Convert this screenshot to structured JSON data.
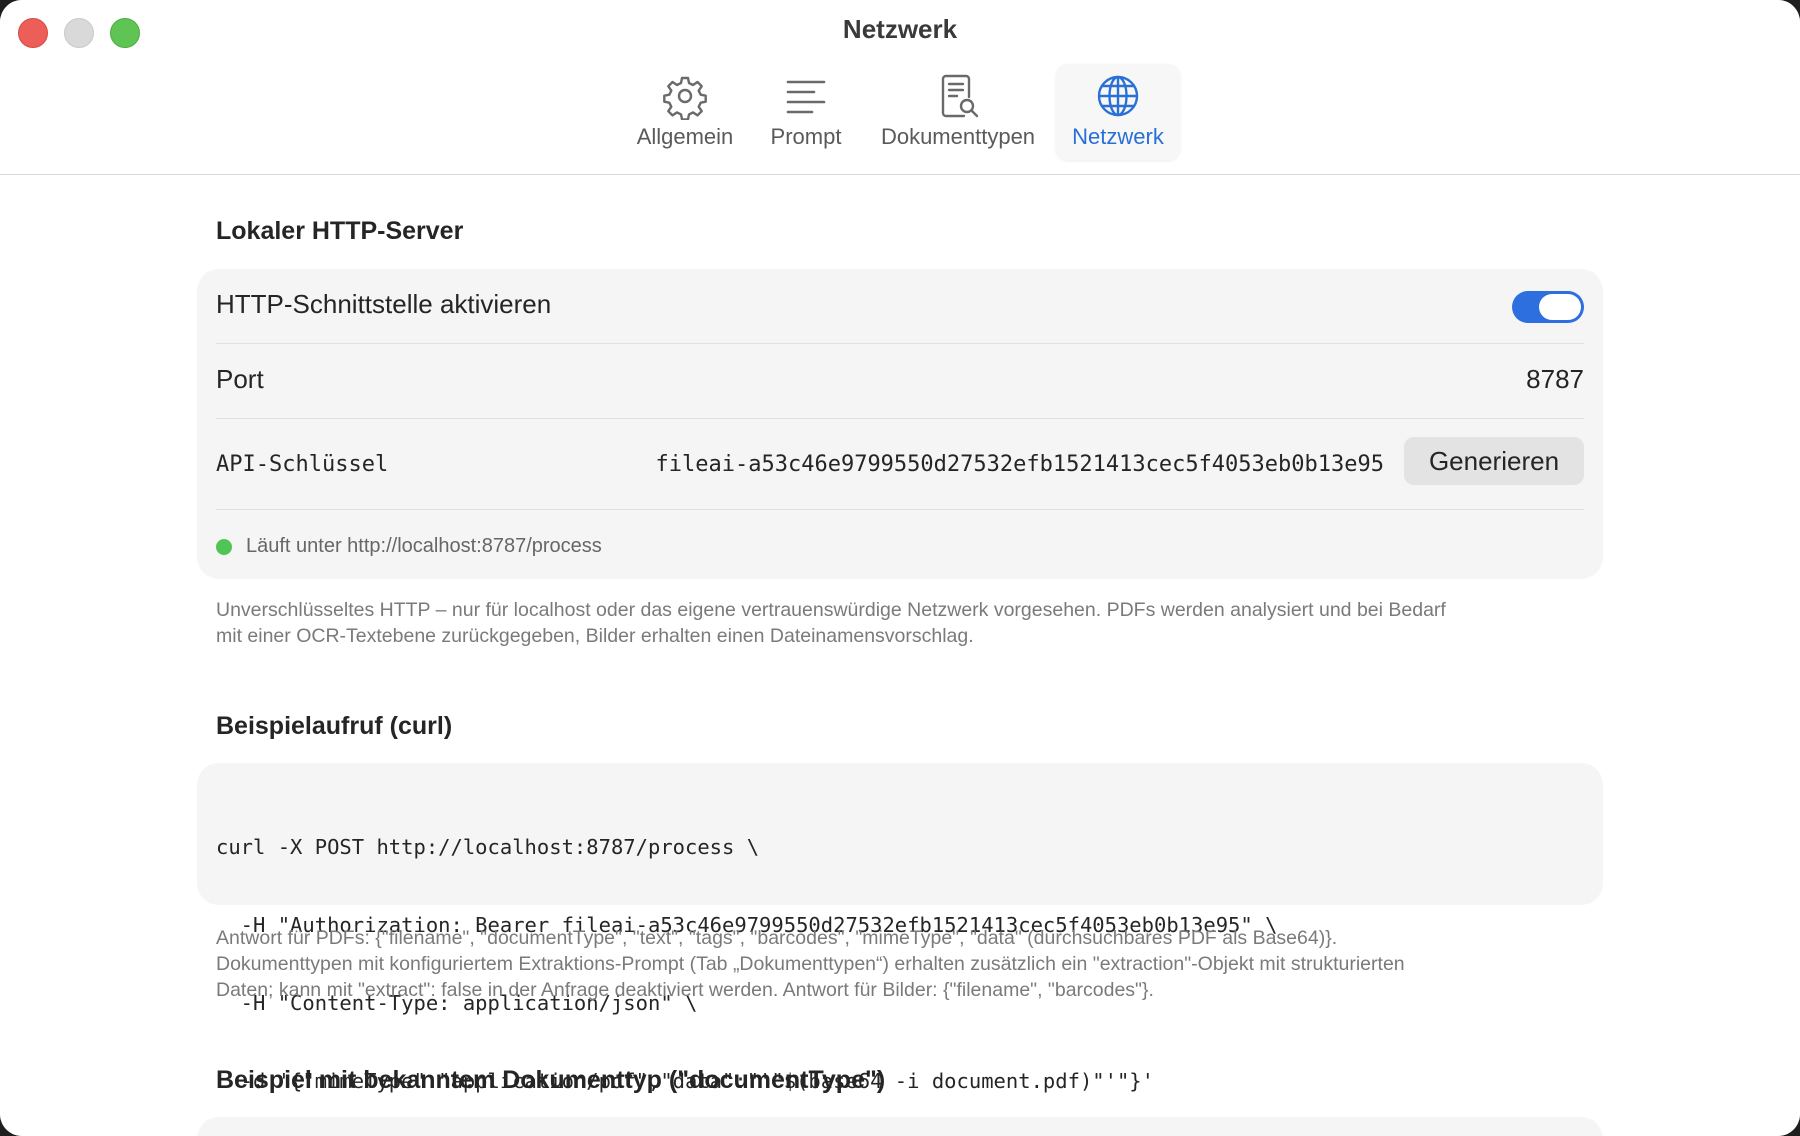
{
  "window": {
    "title": "Netzwerk"
  },
  "tabs": [
    {
      "label": "Allgemein",
      "icon": "gear-icon"
    },
    {
      "label": "Prompt",
      "icon": "text-lines-icon"
    },
    {
      "label": "Dokumenttypen",
      "icon": "document-search-icon"
    },
    {
      "label": "Netzwerk",
      "icon": "globe-icon",
      "active": true
    }
  ],
  "server_section": {
    "title": "Lokaler HTTP-Server",
    "enable_label": "HTTP-Schnittstelle aktivieren",
    "enabled": true,
    "port_label": "Port",
    "port_value": "8787",
    "api_key_label": "API-Schlüssel",
    "api_key_value": "fileai-a53c46e9799550d27532efb1521413cec5f4053eb0b13e95",
    "generate_label": "Generieren",
    "status_text": "Läuft unter http://localhost:8787/process",
    "status_color": "#52c456",
    "note_line1": "Unverschlüsseltes HTTP – nur für localhost oder das eigene vertrauenswürdige Netzwerk vorgesehen. PDFs werden analysiert und bei Bedarf",
    "note_line2": "mit einer OCR-Textebene zurückgegeben, Bilder erhalten einen Dateinamensvorschlag."
  },
  "example_section": {
    "title": "Beispielaufruf (curl)",
    "code_lines": [
      "curl -X POST http://localhost:8787/process \\",
      "  -H \"Authorization: Bearer fileai-a53c46e9799550d27532efb1521413cec5f4053eb0b13e95\" \\",
      "  -H \"Content-Type: application/json\" \\",
      "  -d '{\"mimeType\":\"application/pdf\",\"data\":\"'\"$(base64 -i document.pdf)\"'\"}'"
    ],
    "response_line1": "Antwort für PDFs: {\"filename\", \"documentType\", \"text\", \"tags\", \"barcodes\", \"mimeType\", \"data\" (durchsuchbares PDF als Base64)}.",
    "response_line2": "Dokumenttypen mit konfiguriertem Extraktions-Prompt (Tab „Dokumenttypen“) erhalten zusätzlich ein \"extraction\"-Objekt mit strukturierten",
    "response_line3": "Daten; kann mit \"extract\": false in der Anfrage deaktiviert werden. Antwort für Bilder: {\"filename\", \"barcodes\"}."
  },
  "known_type_section": {
    "title": "Beispiel mit bekanntem Dokumenttyp (\"documentType\")"
  },
  "colors": {
    "accent": "#2a6fd6",
    "toggle_on": "#2e6fe0"
  }
}
